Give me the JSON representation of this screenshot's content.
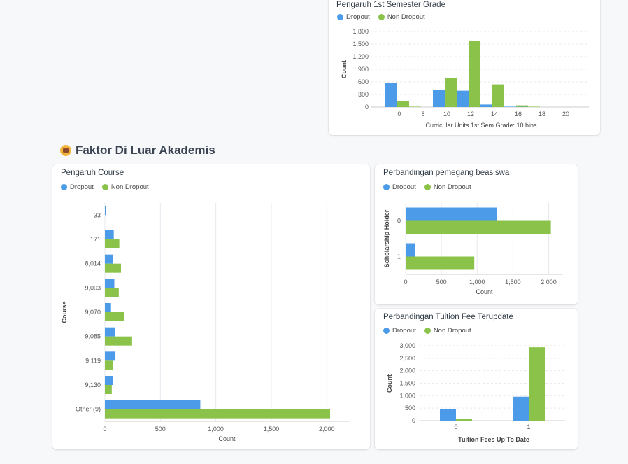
{
  "colors": {
    "dropout": "#4c9be8",
    "non_dropout": "#8bc34a"
  },
  "legend": {
    "dropout": "Dropout",
    "non_dropout": "Non Dropout"
  },
  "section": {
    "title": "Faktor Di Luar Akademis",
    "icon": "family-icon"
  },
  "cards": {
    "semester": {
      "title": "Pengaruh 1st Semester Grade"
    },
    "course": {
      "title": "Pengaruh Course"
    },
    "scholarship": {
      "title": "Perbandingan pemegang beasiswa"
    },
    "tuition": {
      "title": "Perbandingan Tuition Fee Terupdate"
    }
  },
  "chart_data": [
    {
      "id": "semester",
      "type": "bar",
      "title": "Pengaruh 1st Semester Grade",
      "xlabel": "Curricular Units 1st Sem Grade: 10 bins",
      "ylabel": "Count",
      "x_ticks": [
        "0",
        "8",
        "10",
        "12",
        "14",
        "16",
        "18",
        "20"
      ],
      "y_ticks": [
        "0",
        "300",
        "600",
        "900",
        "1,200",
        "1,500",
        "1,800"
      ],
      "ylim": [
        0,
        1800
      ],
      "bins": [
        {
          "x0": -1,
          "x1": 1,
          "dropout": 570,
          "non_dropout": 150
        },
        {
          "x0": 1,
          "x1": 3,
          "dropout": 0,
          "non_dropout": 10
        },
        {
          "x0": 9,
          "x1": 11,
          "dropout": 400,
          "non_dropout": 700
        },
        {
          "x0": 11,
          "x1": 13,
          "dropout": 390,
          "non_dropout": 1580
        },
        {
          "x0": 13,
          "x1": 15,
          "dropout": 60,
          "non_dropout": 540
        },
        {
          "x0": 15,
          "x1": 17,
          "dropout": 10,
          "non_dropout": 40
        },
        {
          "x0": 17,
          "x1": 19,
          "dropout": 5,
          "non_dropout": 10
        }
      ],
      "series": [
        {
          "name": "Dropout"
        },
        {
          "name": "Non Dropout"
        }
      ]
    },
    {
      "id": "course",
      "type": "bar",
      "orientation": "horizontal",
      "title": "Pengaruh Course",
      "xlabel": "Count",
      "ylabel": "Course",
      "categories": [
        "33",
        "171",
        "8,014",
        "9,003",
        "9,070",
        "9,085",
        "9,119",
        "9,130",
        "Other (9)"
      ],
      "series": [
        {
          "name": "Dropout",
          "values": [
            8,
            80,
            70,
            85,
            55,
            90,
            95,
            75,
            860
          ]
        },
        {
          "name": "Non Dropout",
          "values": [
            0,
            130,
            145,
            125,
            175,
            245,
            75,
            62,
            2030
          ]
        }
      ],
      "x_ticks": [
        "0",
        "500",
        "1,000",
        "1,500",
        "2,000"
      ],
      "xlim": [
        0,
        2200
      ]
    },
    {
      "id": "scholarship",
      "type": "bar",
      "orientation": "horizontal",
      "title": "Perbandingan pemegang beasiswa",
      "xlabel": "Count",
      "ylabel": "Scholarship Holder",
      "categories": [
        "0",
        "1"
      ],
      "series": [
        {
          "name": "Dropout",
          "values": [
            1280,
            130
          ]
        },
        {
          "name": "Non Dropout",
          "values": [
            2030,
            960
          ]
        }
      ],
      "x_ticks": [
        "0",
        "500",
        "1,000",
        "1,500",
        "2,000"
      ],
      "xlim": [
        0,
        2200
      ]
    },
    {
      "id": "tuition",
      "type": "bar",
      "title": "Perbandingan Tuition Fee Terupdate",
      "xlabel": "Tuition Fees Up To Date",
      "ylabel": "Count",
      "categories": [
        "0",
        "1"
      ],
      "series": [
        {
          "name": "Dropout",
          "values": [
            460,
            960
          ]
        },
        {
          "name": "Non Dropout",
          "values": [
            80,
            2940
          ]
        }
      ],
      "y_ticks": [
        "0",
        "500",
        "1,000",
        "1,500",
        "2,000",
        "2,500",
        "3,000"
      ],
      "ylim": [
        0,
        3000
      ]
    }
  ]
}
